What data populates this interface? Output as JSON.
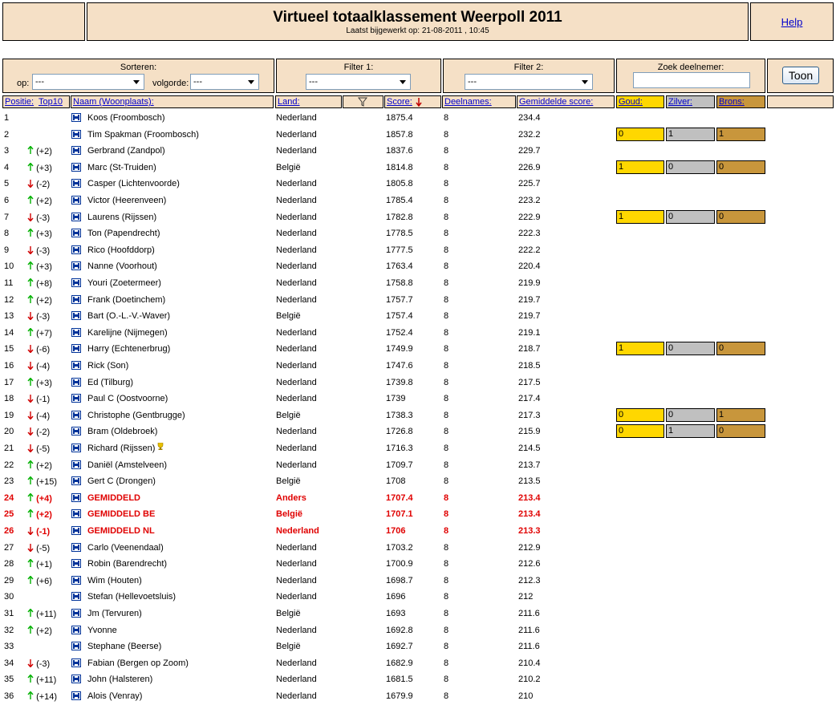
{
  "header": {
    "title": "Virtueel totaalklassement Weerpoll 2011",
    "updated": "Laatst bijgewerkt op: 21-08-2011 , 10:45",
    "help": "Help"
  },
  "controls": {
    "sort_label": "Sorteren:",
    "op_label": "op:",
    "op_value": "---",
    "order_label": "volgorde:",
    "order_value": "---",
    "filter1_label": "Filter 1:",
    "filter1_value": "---",
    "filter2_label": "Filter 2:",
    "filter2_value": "---",
    "search_label": "Zoek deelnemer:",
    "toon": "Toon"
  },
  "columns": {
    "positie": "Positie:",
    "top10": "Top10",
    "naam": "Naam (Woonplaats):",
    "land": "Land:",
    "score": "Score:",
    "deelnames": "Deelnames:",
    "gemiddelde": "Gemiddelde score:",
    "goud": "Goud:",
    "zilver": "Zilver:",
    "brons": "Brons:"
  },
  "colors": {
    "gold": "#ffd700",
    "silver": "#c0c0c0",
    "bronze": "#c8963c",
    "header_bg": "#f5e0c6",
    "highlight": "#e00000"
  },
  "rows": [
    {
      "pos": "1",
      "dir": "",
      "chg": "",
      "name": "Koos (Froombosch)",
      "land": "Nederland",
      "score": "1875.4",
      "deel": "8",
      "avg": "234.4"
    },
    {
      "pos": "2",
      "dir": "",
      "chg": "",
      "name": "Tim Spakman (Froombosch)",
      "land": "Nederland",
      "score": "1857.8",
      "deel": "8",
      "avg": "232.2",
      "medals": [
        "0",
        "1",
        "1"
      ]
    },
    {
      "pos": "3",
      "dir": "up",
      "chg": "(+2)",
      "name": "Gerbrand (Zandpol)",
      "land": "Nederland",
      "score": "1837.6",
      "deel": "8",
      "avg": "229.7"
    },
    {
      "pos": "4",
      "dir": "up",
      "chg": "(+3)",
      "name": "Marc (St-Truiden)",
      "land": "België",
      "score": "1814.8",
      "deel": "8",
      "avg": "226.9",
      "medals": [
        "1",
        "0",
        "0"
      ]
    },
    {
      "pos": "5",
      "dir": "down",
      "chg": "(-2)",
      "name": "Casper (Lichtenvoorde)",
      "land": "Nederland",
      "score": "1805.8",
      "deel": "8",
      "avg": "225.7"
    },
    {
      "pos": "6",
      "dir": "up",
      "chg": "(+2)",
      "name": "Victor (Heerenveen)",
      "land": "Nederland",
      "score": "1785.4",
      "deel": "8",
      "avg": "223.2"
    },
    {
      "pos": "7",
      "dir": "down",
      "chg": "(-3)",
      "name": "Laurens (Rijssen)",
      "land": "Nederland",
      "score": "1782.8",
      "deel": "8",
      "avg": "222.9",
      "medals": [
        "1",
        "0",
        "0"
      ]
    },
    {
      "pos": "8",
      "dir": "up",
      "chg": "(+3)",
      "name": "Ton (Papendrecht)",
      "land": "Nederland",
      "score": "1778.5",
      "deel": "8",
      "avg": "222.3"
    },
    {
      "pos": "9",
      "dir": "down",
      "chg": "(-3)",
      "name": "Rico (Hoofddorp)",
      "land": "Nederland",
      "score": "1777.5",
      "deel": "8",
      "avg": "222.2"
    },
    {
      "pos": "10",
      "dir": "up",
      "chg": "(+3)",
      "name": "Nanne (Voorhout)",
      "land": "Nederland",
      "score": "1763.4",
      "deel": "8",
      "avg": "220.4"
    },
    {
      "pos": "11",
      "dir": "up",
      "chg": "(+8)",
      "name": "Youri (Zoetermeer)",
      "land": "Nederland",
      "score": "1758.8",
      "deel": "8",
      "avg": "219.9"
    },
    {
      "pos": "12",
      "dir": "up",
      "chg": "(+2)",
      "name": "Frank (Doetinchem)",
      "land": "Nederland",
      "score": "1757.7",
      "deel": "8",
      "avg": "219.7"
    },
    {
      "pos": "13",
      "dir": "down",
      "chg": "(-3)",
      "name": "Bart (O.-L.-V.-Waver)",
      "land": "België",
      "score": "1757.4",
      "deel": "8",
      "avg": "219.7"
    },
    {
      "pos": "14",
      "dir": "up",
      "chg": "(+7)",
      "name": "Karelijne (Nijmegen)",
      "land": "Nederland",
      "score": "1752.4",
      "deel": "8",
      "avg": "219.1"
    },
    {
      "pos": "15",
      "dir": "down",
      "chg": "(-6)",
      "name": "Harry (Echtenerbrug)",
      "land": "Nederland",
      "score": "1749.9",
      "deel": "8",
      "avg": "218.7",
      "medals": [
        "1",
        "0",
        "0"
      ]
    },
    {
      "pos": "16",
      "dir": "down",
      "chg": "(-4)",
      "name": "Rick (Son)",
      "land": "Nederland",
      "score": "1747.6",
      "deel": "8",
      "avg": "218.5"
    },
    {
      "pos": "17",
      "dir": "up",
      "chg": "(+3)",
      "name": "Ed (Tilburg)",
      "land": "Nederland",
      "score": "1739.8",
      "deel": "8",
      "avg": "217.5"
    },
    {
      "pos": "18",
      "dir": "down",
      "chg": "(-1)",
      "name": "Paul C (Oostvoorne)",
      "land": "Nederland",
      "score": "1739",
      "deel": "8",
      "avg": "217.4"
    },
    {
      "pos": "19",
      "dir": "down",
      "chg": "(-4)",
      "name": "Christophe (Gentbrugge)",
      "land": "België",
      "score": "1738.3",
      "deel": "8",
      "avg": "217.3",
      "medals": [
        "0",
        "0",
        "1"
      ]
    },
    {
      "pos": "20",
      "dir": "down",
      "chg": "(-2)",
      "name": "Bram (Oldebroek)",
      "land": "Nederland",
      "score": "1726.8",
      "deel": "8",
      "avg": "215.9",
      "medals": [
        "0",
        "1",
        "0"
      ]
    },
    {
      "pos": "21",
      "dir": "down",
      "chg": "(-5)",
      "name": "Richard (Rijssen)",
      "land": "Nederland",
      "score": "1716.3",
      "deel": "8",
      "avg": "214.5",
      "trophy": true
    },
    {
      "pos": "22",
      "dir": "up",
      "chg": "(+2)",
      "name": "Daniël (Amstelveen)",
      "land": "Nederland",
      "score": "1709.7",
      "deel": "8",
      "avg": "213.7"
    },
    {
      "pos": "23",
      "dir": "up",
      "chg": "(+15)",
      "name": "Gert C (Drongen)",
      "land": "België",
      "score": "1708",
      "deel": "8",
      "avg": "213.5"
    },
    {
      "pos": "24",
      "dir": "up",
      "chg": "(+4)",
      "name": "GEMIDDELD",
      "land": "Anders",
      "score": "1707.4",
      "deel": "8",
      "avg": "213.4",
      "hl": true
    },
    {
      "pos": "25",
      "dir": "up",
      "chg": "(+2)",
      "name": "GEMIDDELD BE",
      "land": "België",
      "score": "1707.1",
      "deel": "8",
      "avg": "213.4",
      "hl": true
    },
    {
      "pos": "26",
      "dir": "down",
      "chg": "(-1)",
      "name": "GEMIDDELD NL",
      "land": "Nederland",
      "score": "1706",
      "deel": "8",
      "avg": "213.3",
      "hl": true
    },
    {
      "pos": "27",
      "dir": "down",
      "chg": "(-5)",
      "name": "Carlo (Veenendaal)",
      "land": "Nederland",
      "score": "1703.2",
      "deel": "8",
      "avg": "212.9"
    },
    {
      "pos": "28",
      "dir": "up",
      "chg": "(+1)",
      "name": "Robin (Barendrecht)",
      "land": "Nederland",
      "score": "1700.9",
      "deel": "8",
      "avg": "212.6"
    },
    {
      "pos": "29",
      "dir": "up",
      "chg": "(+6)",
      "name": "Wim (Houten)",
      "land": "Nederland",
      "score": "1698.7",
      "deel": "8",
      "avg": "212.3"
    },
    {
      "pos": "30",
      "dir": "",
      "chg": "",
      "name": "Stefan (Hellevoetsluis)",
      "land": "Nederland",
      "score": "1696",
      "deel": "8",
      "avg": "212"
    },
    {
      "pos": "31",
      "dir": "up",
      "chg": "(+11)",
      "name": "Jm (Tervuren)",
      "land": "België",
      "score": "1693",
      "deel": "8",
      "avg": "211.6"
    },
    {
      "pos": "32",
      "dir": "up",
      "chg": "(+2)",
      "name": "Yvonne",
      "land": "Nederland",
      "score": "1692.8",
      "deel": "8",
      "avg": "211.6"
    },
    {
      "pos": "33",
      "dir": "",
      "chg": "",
      "name": "Stephane (Beerse)",
      "land": "België",
      "score": "1692.7",
      "deel": "8",
      "avg": "211.6"
    },
    {
      "pos": "34",
      "dir": "down",
      "chg": "(-3)",
      "name": "Fabian (Bergen op Zoom)",
      "land": "Nederland",
      "score": "1682.9",
      "deel": "8",
      "avg": "210.4"
    },
    {
      "pos": "35",
      "dir": "up",
      "chg": "(+11)",
      "name": "John (Halsteren)",
      "land": "Nederland",
      "score": "1681.5",
      "deel": "8",
      "avg": "210.2"
    },
    {
      "pos": "36",
      "dir": "up",
      "chg": "(+14)",
      "name": "Alois (Venray)",
      "land": "Nederland",
      "score": "1679.9",
      "deel": "8",
      "avg": "210"
    }
  ]
}
